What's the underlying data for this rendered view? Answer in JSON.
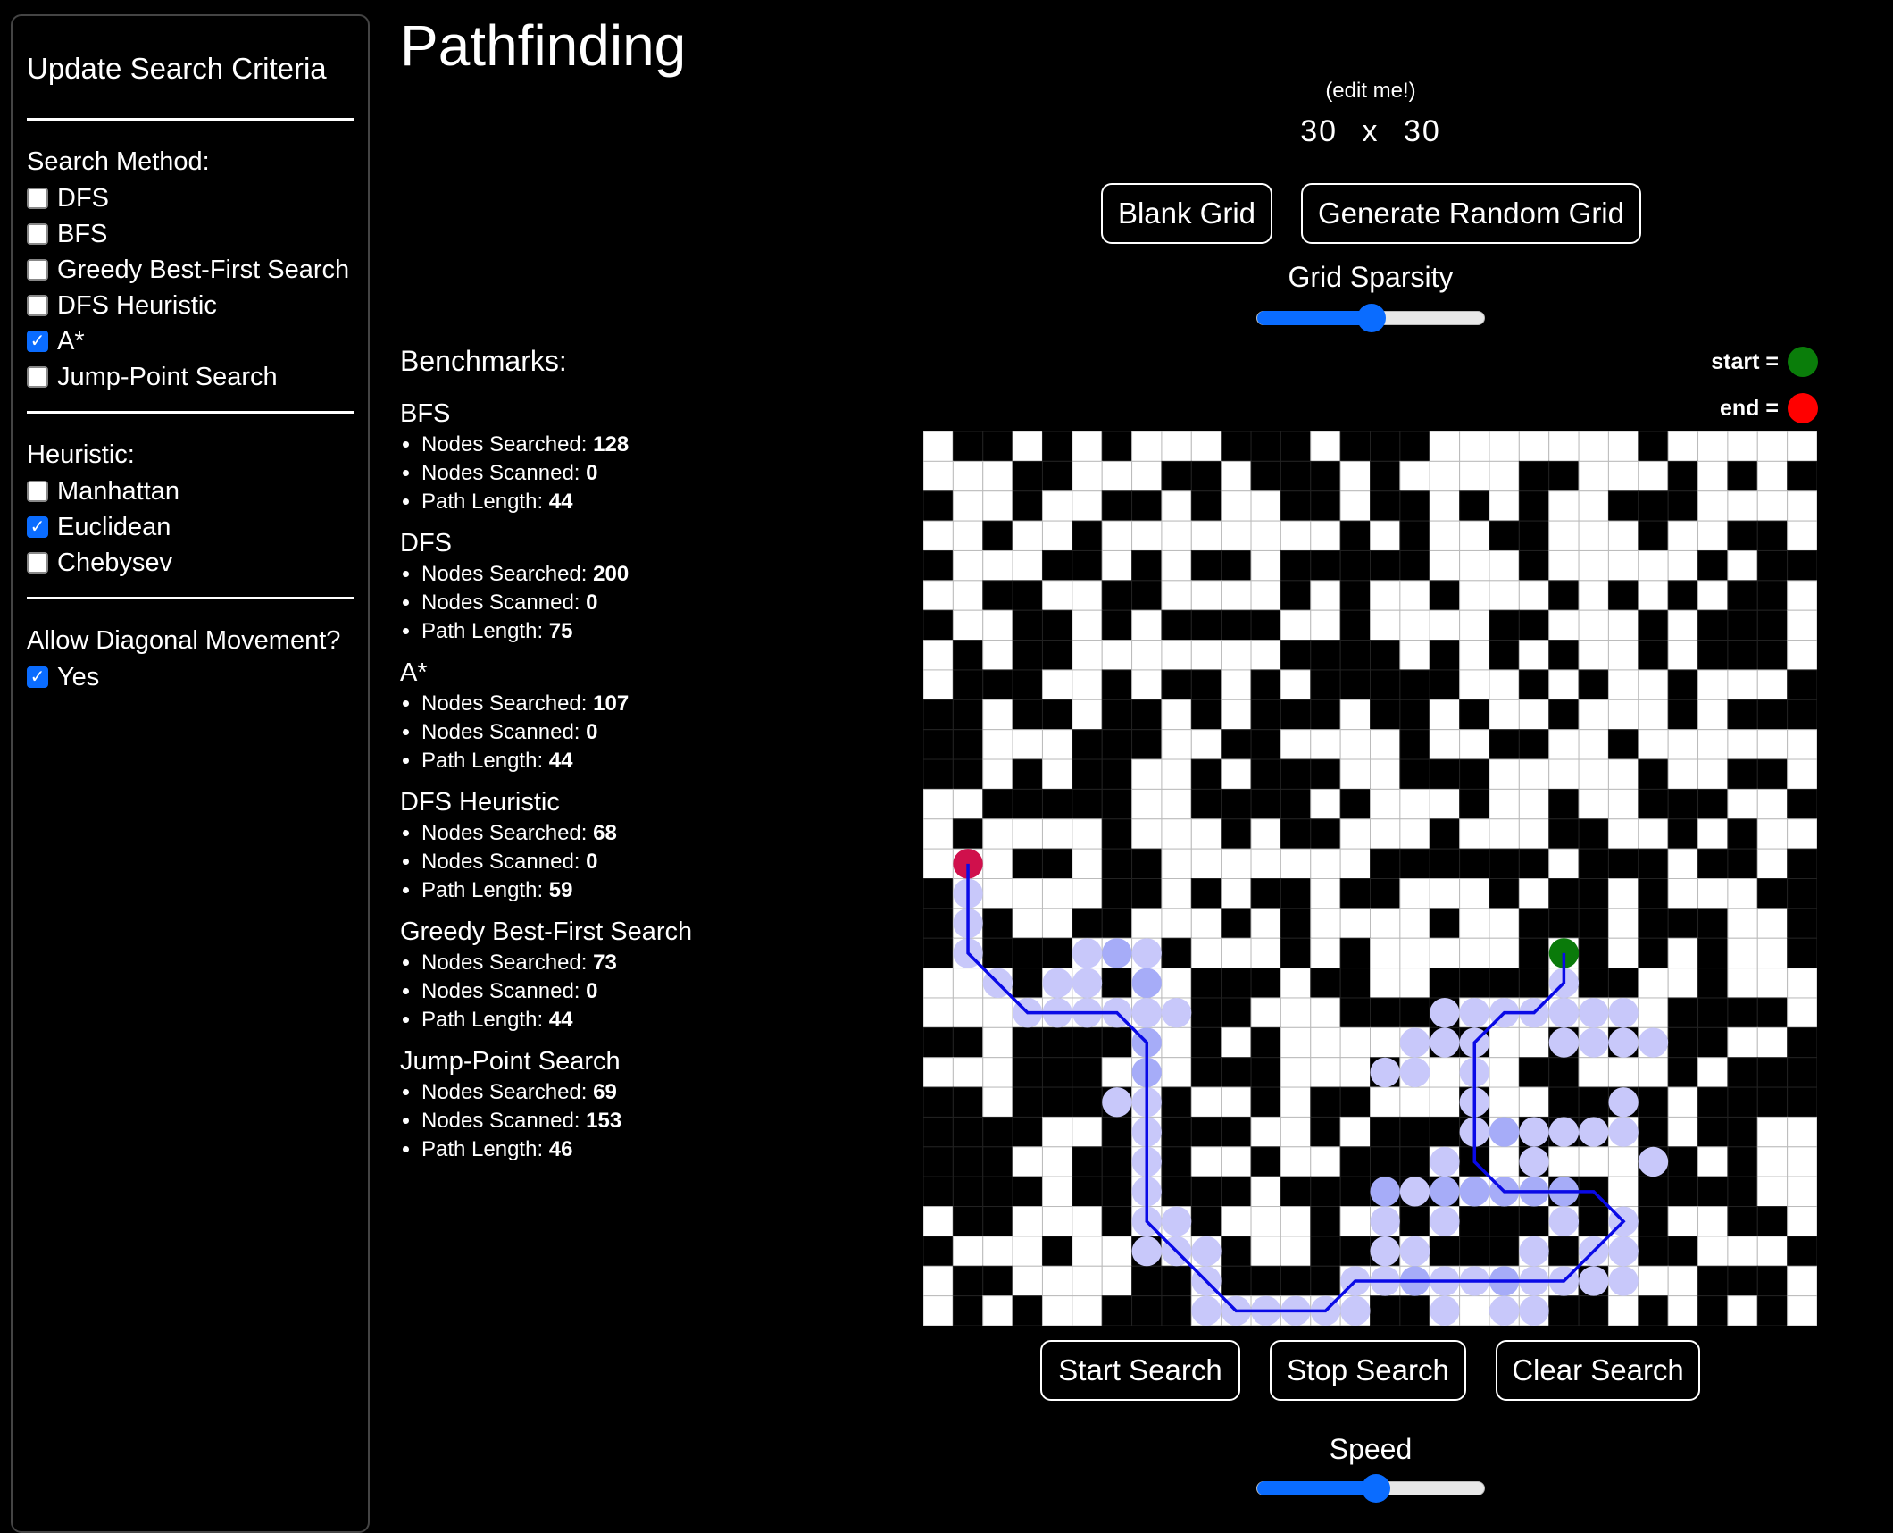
{
  "sidebar": {
    "title": "Update Search Criteria",
    "search_method": {
      "label": "Search Method:",
      "options": [
        {
          "label": "DFS",
          "checked": false
        },
        {
          "label": "BFS",
          "checked": false
        },
        {
          "label": "Greedy Best-First Search",
          "checked": false
        },
        {
          "label": "DFS Heuristic",
          "checked": false
        },
        {
          "label": "A*",
          "checked": true
        },
        {
          "label": "Jump-Point Search",
          "checked": false
        }
      ]
    },
    "heuristic": {
      "label": "Heuristic:",
      "options": [
        {
          "label": "Manhattan",
          "checked": false
        },
        {
          "label": "Euclidean",
          "checked": true
        },
        {
          "label": "Chebysev",
          "checked": false
        }
      ]
    },
    "diagonal": {
      "label": "Allow Diagonal Movement?",
      "options": [
        {
          "label": "Yes",
          "checked": true
        }
      ]
    }
  },
  "header": {
    "title": "Pathfinding",
    "edit_hint": "(edit me!)",
    "rows": "30",
    "times": "x",
    "cols": "30"
  },
  "controls": {
    "blank_grid": "Blank Grid",
    "random_grid": "Generate Random Grid",
    "sparsity_label": "Grid Sparsity",
    "sparsity_value": 0.5,
    "start_search": "Start Search",
    "stop_search": "Stop Search",
    "clear_search": "Clear Search",
    "speed_label": "Speed",
    "speed_value": 0.52
  },
  "legend": {
    "start_label": "start =",
    "end_label": "end =",
    "start_color": "#0a7d0a",
    "end_color": "#ff0000"
  },
  "benchmarks": {
    "title": "Benchmarks:",
    "searched_label": "Nodes Searched:",
    "scanned_label": "Nodes Scanned:",
    "length_label": "Path Length:",
    "items": [
      {
        "name": "BFS",
        "searched": "128",
        "scanned": "0",
        "length": "44"
      },
      {
        "name": "DFS",
        "searched": "200",
        "scanned": "0",
        "length": "75"
      },
      {
        "name": "A*",
        "searched": "107",
        "scanned": "0",
        "length": "44"
      },
      {
        "name": "DFS Heuristic",
        "searched": "68",
        "scanned": "0",
        "length": "59"
      },
      {
        "name": "Greedy Best-First Search",
        "searched": "73",
        "scanned": "0",
        "length": "44"
      },
      {
        "name": "Jump-Point Search",
        "searched": "69",
        "scanned": "153",
        "length": "46"
      }
    ]
  },
  "grid": {
    "rows": 30,
    "cols": 30,
    "colors": {
      "wall": "#000000",
      "open": "#ffffff",
      "line": "#bbbbbb",
      "visited": "#c8c8fa",
      "frontier": "#a6acf8",
      "path": "#0a0ae6",
      "end_marker": "#d0104c",
      "start_marker": "#0a7a0a"
    },
    "walls": [
      "011010100011101110000000100000",
      "000110001101110100001100010101",
      "100100110100110110101001110000",
      "001001000000001010011000100110",
      "100011010110111110001000001011",
      "001100110000101001000101010110",
      "100110101111001000011000101110",
      "010110000000111101010100101110",
      "011100101101011111001010010001",
      "110110110101110110100100010111",
      "110001110011000010011001000000",
      "110101100101110011100000100110",
      "001111100111101000100100111001",
      "010000100010110001000110010100",
      "000110110000000111111011101101",
      "100000110101101100010110100011",
      "101001100010100001001110111001",
      "101110001000101000001010101001",
      "000100100111011001111011001000",
      "000000000110001111000000011110",
      "110111100101000001100101011001",
      "000111000111000100001100010111",
      "110111101001011000100111101111",
      "111100101110010111101110101100",
      "111001101001001110101000110100",
      "111101101110111111000110111100",
      "011000100100010010111010100110",
      "100010010010011101110100110001",
      "011000011011110000000010001110",
      "010100111000000110000110101010"
    ],
    "end": [
      14,
      1
    ],
    "start": [
      17,
      21
    ],
    "frontier": [
      [
        17,
        6
      ],
      [
        18,
        7
      ],
      [
        20,
        7
      ],
      [
        21,
        7
      ],
      [
        23,
        19
      ],
      [
        25,
        15
      ],
      [
        25,
        17
      ],
      [
        25,
        18
      ],
      [
        25,
        19
      ],
      [
        25,
        20
      ],
      [
        25,
        21
      ],
      [
        28,
        16
      ],
      [
        28,
        19
      ]
    ],
    "visited": [
      [
        15,
        1
      ],
      [
        16,
        1
      ],
      [
        17,
        1
      ],
      [
        17,
        5
      ],
      [
        17,
        7
      ],
      [
        18,
        2
      ],
      [
        18,
        4
      ],
      [
        18,
        5
      ],
      [
        19,
        3
      ],
      [
        19,
        4
      ],
      [
        19,
        5
      ],
      [
        19,
        6
      ],
      [
        19,
        7
      ],
      [
        19,
        8
      ],
      [
        22,
        7
      ],
      [
        22,
        6
      ],
      [
        23,
        7
      ],
      [
        24,
        7
      ],
      [
        25,
        7
      ],
      [
        26,
        7
      ],
      [
        27,
        7
      ],
      [
        26,
        8
      ],
      [
        27,
        8
      ],
      [
        27,
        9
      ],
      [
        28,
        9
      ],
      [
        29,
        9
      ],
      [
        29,
        10
      ],
      [
        29,
        11
      ],
      [
        29,
        12
      ],
      [
        29,
        13
      ],
      [
        29,
        14
      ],
      [
        28,
        14
      ],
      [
        28,
        15
      ],
      [
        28,
        17
      ],
      [
        28,
        18
      ],
      [
        28,
        20
      ],
      [
        28,
        21
      ],
      [
        28,
        22
      ],
      [
        29,
        17
      ],
      [
        29,
        19
      ],
      [
        29,
        20
      ],
      [
        18,
        21
      ],
      [
        19,
        17
      ],
      [
        19,
        18
      ],
      [
        19,
        19
      ],
      [
        19,
        20
      ],
      [
        19,
        21
      ],
      [
        19,
        22
      ],
      [
        19,
        23
      ],
      [
        20,
        16
      ],
      [
        20,
        17
      ],
      [
        20,
        18
      ],
      [
        20,
        21
      ],
      [
        20,
        22
      ],
      [
        20,
        23
      ],
      [
        20,
        24
      ],
      [
        21,
        15
      ],
      [
        21,
        16
      ],
      [
        21,
        18
      ],
      [
        22,
        18
      ],
      [
        22,
        23
      ],
      [
        23,
        18
      ],
      [
        23,
        20
      ],
      [
        23,
        21
      ],
      [
        23,
        22
      ],
      [
        23,
        23
      ],
      [
        24,
        17
      ],
      [
        24,
        20
      ],
      [
        24,
        24
      ],
      [
        25,
        16
      ],
      [
        26,
        15
      ],
      [
        26,
        17
      ],
      [
        26,
        21
      ],
      [
        26,
        23
      ],
      [
        27,
        15
      ],
      [
        27,
        16
      ],
      [
        27,
        20
      ],
      [
        27,
        22
      ],
      [
        27,
        23
      ],
      [
        28,
        23
      ]
    ],
    "path": [
      [
        14,
        1
      ],
      [
        17,
        1
      ],
      [
        19,
        3
      ],
      [
        19,
        6
      ],
      [
        20,
        7
      ],
      [
        26,
        7
      ],
      [
        29,
        10
      ],
      [
        29,
        13
      ],
      [
        28,
        14
      ],
      [
        28,
        21
      ],
      [
        26,
        23
      ],
      [
        25,
        22
      ],
      [
        25,
        19
      ],
      [
        24,
        18
      ],
      [
        20,
        18
      ],
      [
        19,
        19
      ],
      [
        19,
        20
      ],
      [
        18,
        21
      ],
      [
        17,
        21
      ]
    ]
  }
}
